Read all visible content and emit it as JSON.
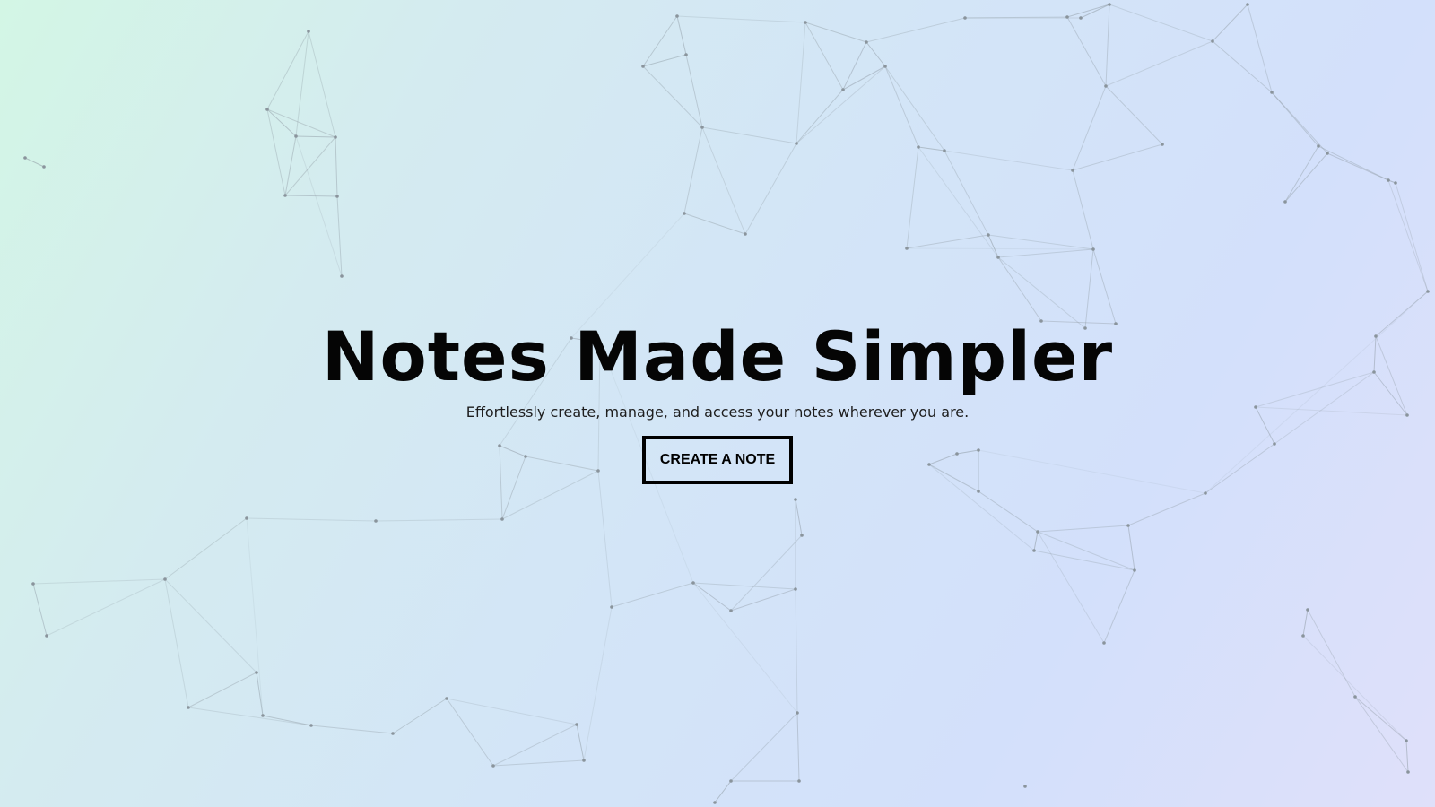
{
  "hero": {
    "title": "Notes Made Simpler",
    "subtitle": "Effortlessly create, manage, and access your notes wherever you are.",
    "cta_label": "CREATE A NOTE"
  },
  "colors": {
    "background_start": "#d3f6e5",
    "background_end": "#dfe0fa",
    "network_line": "#8f9aa3",
    "text": "#050505"
  }
}
